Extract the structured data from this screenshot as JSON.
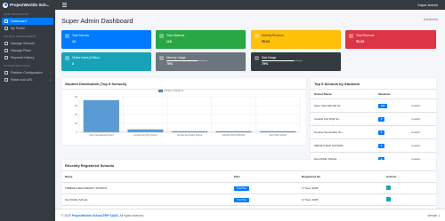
{
  "brand": {
    "name": "ProjectWorlds Sch..."
  },
  "user": {
    "name": "Super Admin"
  },
  "sidebar": {
    "headers": {
      "main": "MAIN NAVIGATION",
      "school": "SCHOOL MANAGEMENT",
      "system": "SYSTEM SETTINGS"
    },
    "items": [
      {
        "label": "Dashboard"
      },
      {
        "label": "My Profile"
      },
      {
        "label": "Manage Schools"
      },
      {
        "label": "Manage Plans"
      },
      {
        "label": "Payment History"
      },
      {
        "label": "Platform Configuration"
      },
      {
        "label": "Reset And URL"
      }
    ]
  },
  "page": {
    "title": "Super Admin Dashboard",
    "breadcrumb": "Dashboard"
  },
  "cards": [
    {
      "label": "Total Schools",
      "value": "12",
      "color": "#007bff"
    },
    {
      "label": "Total Students",
      "value": "118",
      "color": "#28a745"
    },
    {
      "label": "Monthly Revenue",
      "value": "₹0.00",
      "color": "#ffc107"
    },
    {
      "label": "Total Revenue",
      "value": "₹0.00",
      "color": "#dc3545"
    },
    {
      "label": "Online Users (5 Mins)",
      "value": "3",
      "color": "#17a2b8"
    },
    {
      "label": "Memory Usage",
      "value": "76%",
      "color": "#6c757d",
      "progress": 0.76
    },
    {
      "label": "Disk Usage",
      "value": "79%",
      "color": "#343a40",
      "progress": 0.79
    }
  ],
  "chart_panel": {
    "title": "Student Distribution (Top 5 Schools)"
  },
  "chart_data": {
    "type": "bar",
    "categories": [
      "Apex International School",
      "Central City High School",
      "Sunrise Secondary School",
      "INDIAN HIGH SCHOOL",
      "Sun Public School"
    ],
    "series": [
      {
        "name": "Number of Students",
        "values": [
          36,
          3,
          1,
          1,
          1
        ]
      }
    ],
    "ylim": [
      0,
      40
    ],
    "yticks": [
      0,
      10,
      20,
      30,
      40
    ]
  },
  "top5": {
    "title": "Top 5 Schools by Students",
    "col_name": "School Name",
    "col_students": "Students",
    "rows": [
      {
        "name": "Apex International Sc...",
        "students": "108",
        "link": "Analytics"
      },
      {
        "name": "Central City High Sc...",
        "students": "3",
        "link": "Analytics"
      },
      {
        "name": "Sunrise Secondary Sc...",
        "students": "3",
        "link": "Analytics"
      },
      {
        "name": "INDIAN HIGH SCHOOL",
        "students": "2",
        "link": "Analytics"
      },
      {
        "name": "Sun Public School",
        "students": "2",
        "link": "Analytics"
      }
    ]
  },
  "recent": {
    "title": "Recently Registered Schools",
    "cols": {
      "name": "Name",
      "plan": "Plan",
      "registered": "Registered On",
      "actions": "Actions"
    },
    "rows": [
      {
        "name": "TIMBAZA SECONDARY SCHOOL",
        "plan": "Trial Plan",
        "registered": "17 Sep, 2025"
      },
      {
        "name": "Sun Public School",
        "plan": "Trial Plan",
        "registered": "17 Sep, 2025"
      }
    ]
  },
  "footer": {
    "prefix": "© 2025",
    "brand": "ProjectWorlds School ERP SAAS.",
    "suffix": "All rights reserved.",
    "version": "Version 1"
  }
}
